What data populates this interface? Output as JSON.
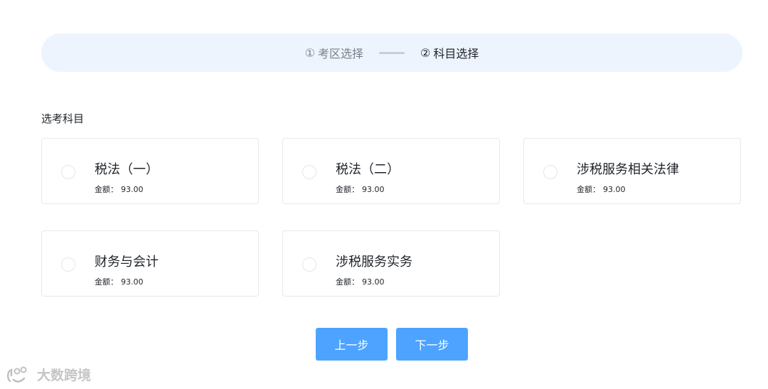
{
  "steps": {
    "step1_num": "①",
    "step1_label": "考区选择",
    "step2_num": "②",
    "step2_label": "科目选择"
  },
  "section_label": "选考科目",
  "price_label": "金额：",
  "subjects": [
    {
      "name": "税法（一）",
      "price": "93.00"
    },
    {
      "name": "税法（二）",
      "price": "93.00"
    },
    {
      "name": "涉税服务相关法律",
      "price": "93.00"
    },
    {
      "name": "财务与会计",
      "price": "93.00"
    },
    {
      "name": "涉税服务实务",
      "price": "93.00"
    }
  ],
  "buttons": {
    "prev": "上一步",
    "next": "下一步"
  },
  "watermark": "大数跨境"
}
